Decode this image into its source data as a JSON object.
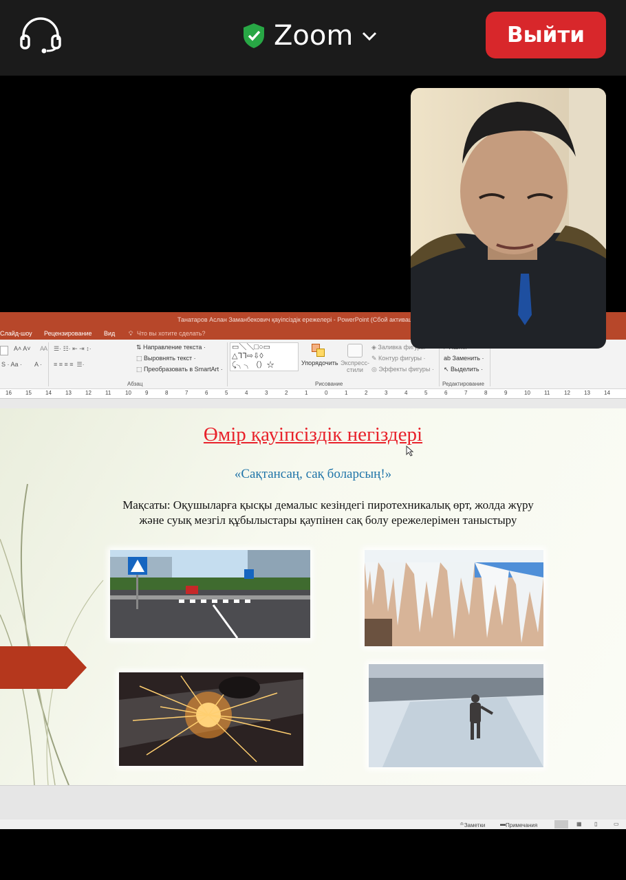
{
  "zoom": {
    "app_title": "Zoom",
    "exit_label": "Выйти",
    "colors": {
      "bar": "#1b1b1b",
      "exit": "#d8272b",
      "shield": "#28a745"
    }
  },
  "powerpoint": {
    "window_title": "Танатаров Аслан Заманбекович қауіпсіздік ережелері - PowerPoint (Сбой активации продукта)",
    "tabs": [
      "Слайд-шоу",
      "Рецензирование",
      "Вид"
    ],
    "tell_me": "Что вы хотите сделать?",
    "ribbon": {
      "text_direction": "Направление текста",
      "align_text": "Выровнять текст",
      "smartart": "Преобразовать в SmartArt",
      "arrange": "Упорядочить",
      "express_1": "Экспресс-",
      "express_2": "стили",
      "fill": "Заливка фигуры",
      "outline": "Контур фигуры",
      "effects": "Эффекты фигуры",
      "find": "Найти",
      "replace": "Заменить",
      "select": "Выделить",
      "group_paragraph": "Абзац",
      "group_drawing": "Рисование",
      "group_editing": "Редактирование"
    },
    "ruler_ticks": [
      "16",
      "15",
      "14",
      "13",
      "12",
      "11",
      "10",
      "9",
      "8",
      "7",
      "6",
      "5",
      "4",
      "3",
      "2",
      "1",
      "0",
      "1",
      "2",
      "3",
      "4",
      "5",
      "6",
      "7",
      "8",
      "9",
      "10",
      "11",
      "12",
      "13",
      "14"
    ],
    "status": {
      "notes": "Заметки",
      "comments": "Примечания"
    },
    "accent": "#b7472a"
  },
  "slide": {
    "title": "Өмір қауіпсіздік негіздері",
    "subtitle": "«Сақтансаң, сақ боларсың!»",
    "goal_line1": "Мақсаты: Оқушыларға қысқы демалыс кезіндегі пиротехникалық өрт, жолда жүру",
    "goal_line2": "және суық мезгіл құбылыстары қаупінен сақ болу ережелерімен таныстыру",
    "images": [
      "road-crosswalk-photo",
      "icicles-photo",
      "sparks-photo",
      "icy-sidewalk-photo"
    ],
    "colors": {
      "title": "#e8222b",
      "subtitle": "#1f74a8"
    }
  },
  "participant_video": {
    "label": "participant-video"
  }
}
